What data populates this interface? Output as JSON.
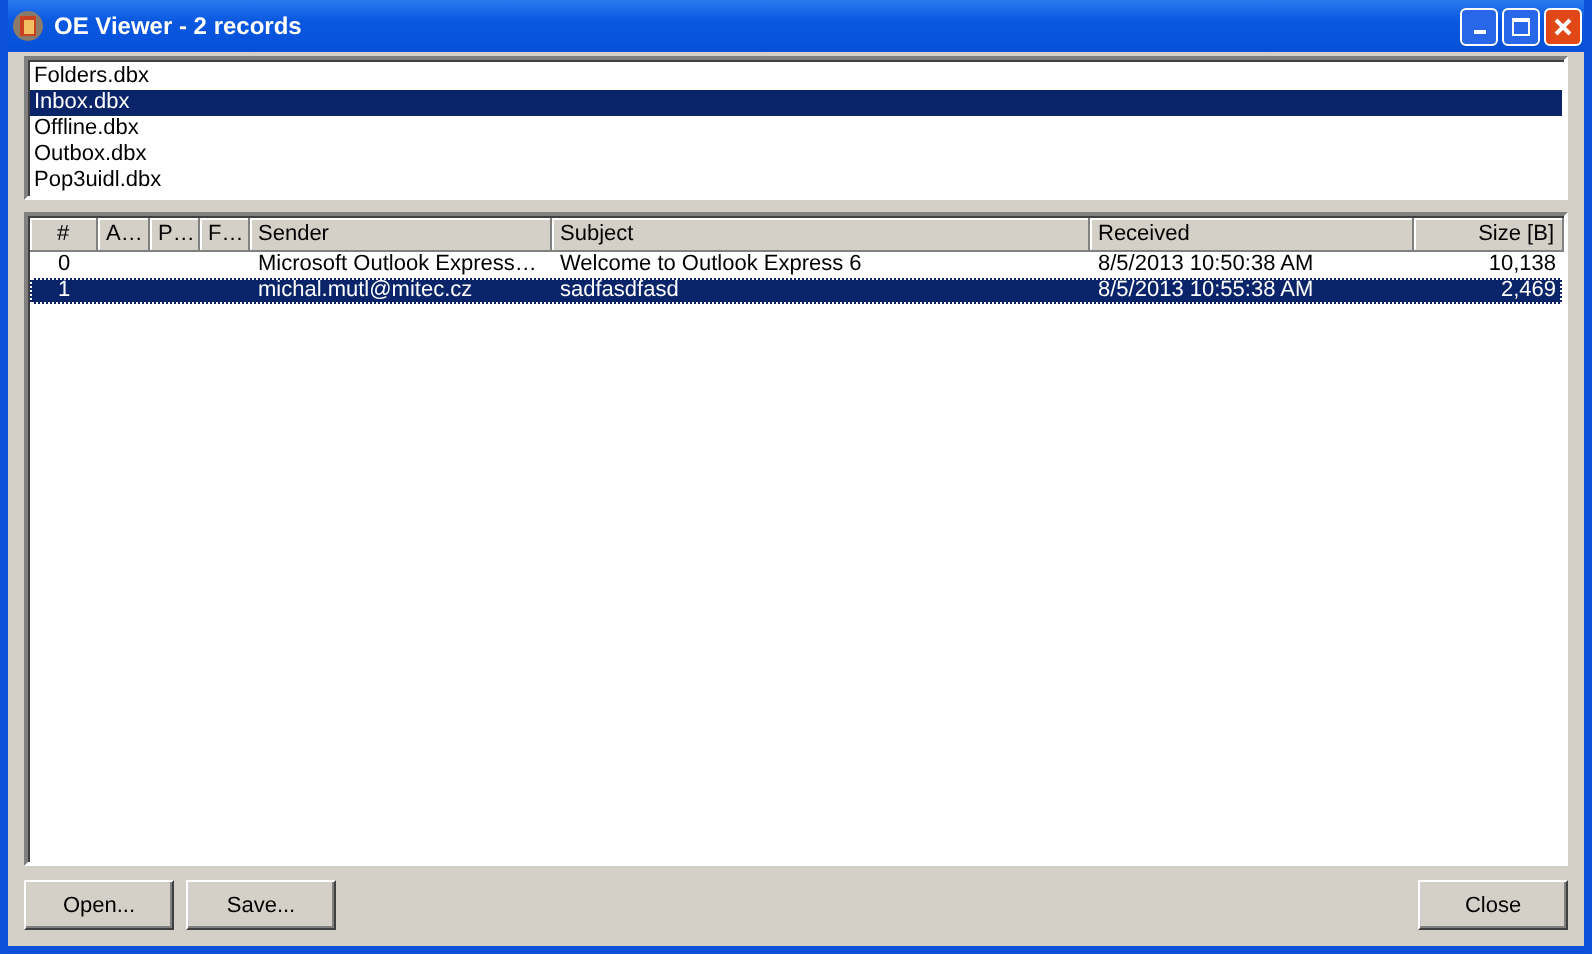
{
  "window": {
    "title": "OE Viewer - 2 records"
  },
  "files": [
    {
      "name": "Folders.dbx",
      "selected": false
    },
    {
      "name": "Inbox.dbx",
      "selected": true
    },
    {
      "name": "Offline.dbx",
      "selected": false
    },
    {
      "name": "Outbox.dbx",
      "selected": false
    },
    {
      "name": "Pop3uidl.dbx",
      "selected": false
    }
  ],
  "table": {
    "columns": [
      {
        "label": "#"
      },
      {
        "label": "A…"
      },
      {
        "label": "P…"
      },
      {
        "label": "F…"
      },
      {
        "label": "Sender"
      },
      {
        "label": "Subject"
      },
      {
        "label": "Received"
      },
      {
        "label": "Size [B]"
      }
    ],
    "rows": [
      {
        "cells": [
          "0",
          "",
          "",
          "",
          "Microsoft Outlook Express…",
          "Welcome to Outlook Express 6",
          "8/5/2013 10:50:38 AM",
          "10,138"
        ],
        "selected": false
      },
      {
        "cells": [
          "1",
          "",
          "",
          "",
          "michal.mutl@mitec.cz",
          "sadfasdfasd",
          "8/5/2013 10:55:38 AM",
          "2,469"
        ],
        "selected": true
      }
    ]
  },
  "buttons_left": [
    "Open...",
    "Save..."
  ],
  "buttons_right": [
    "Close"
  ]
}
